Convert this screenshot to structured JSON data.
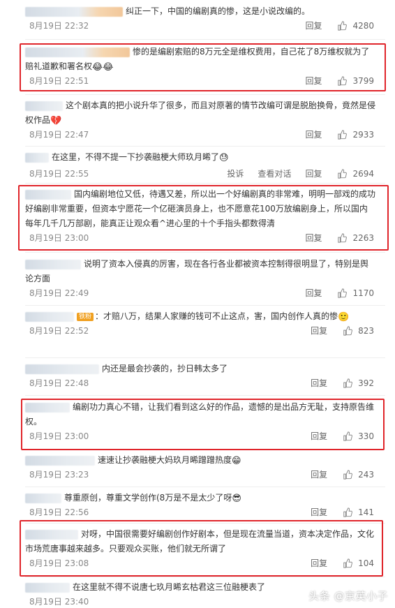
{
  "labels": {
    "reply": "回复",
    "report": "投诉",
    "view_conversation": "查看对话"
  },
  "comments": [
    {
      "text": "纠正一下，中国的编剧真的惨，这是小说改编的。",
      "emoji": "",
      "badge": "",
      "time": "8月19日 22:32",
      "likes": "4280",
      "highlighted": false
    },
    {
      "text": "惨的是编剧索赔的8万元全是维权费用，自己花了8万维权就为了赔礼道歉和署名权",
      "emoji": "😂😂",
      "badge": "",
      "time": "8月19日 22:51",
      "likes": "3799",
      "highlighted": true
    },
    {
      "text": "这个剧本真的把小说升华了很多，而且对原著的情节改编可谓是脱胎换骨，竟然是侵权作品",
      "emoji": "💔",
      "badge": "",
      "time": "8月19日 22:47",
      "likes": "2933",
      "highlighted": false
    },
    {
      "text": "在这里，不得不提一下抄袭融梗大师玖月晞了",
      "emoji": "😓",
      "badge": "",
      "time": "8月19日 22:55",
      "likes": "2694",
      "highlighted": false,
      "extra_actions": true
    },
    {
      "text": "国内编剧地位又低，待遇又差，所以出一个好编剧真的非常难，明明一部戏的成功好编剧非常重要，但资本宁愿花一个亿砸演员身上，也不愿意花100万放编剧身上，所以国内每年几千几万部剧，能真正让观众看^进心里的十个手指头都数得清",
      "emoji": "",
      "badge": "",
      "time": "8月19日 23:00",
      "likes": "2263",
      "highlighted": true
    },
    {
      "text": "说明了资本入侵真的厉害，现在各行各业都被资本控制得很明显了，特别是舆论方面",
      "emoji": "",
      "badge": "",
      "time": "8月19日 22:49",
      "likes": "1170",
      "highlighted": false
    },
    {
      "text": "：才赔八万，结果人家赚的钱可不止这点，害，国内创作人真的惨",
      "emoji": "🙂",
      "badge": "铁粉",
      "time": "8月19日 22:52",
      "likes": "823",
      "highlighted": false
    },
    {
      "text": "内还是最会抄袭的，抄日韩太多了",
      "emoji": "",
      "badge": "",
      "time": "8月19日 22:48",
      "likes": "392",
      "highlighted": false
    },
    {
      "text": "编剧功力真心不错，让我们看到这么好的作品，遗憾的是出品方无耻，支持原告维权。",
      "emoji": "",
      "badge": "",
      "time": "8月19日 23:00",
      "likes": "330",
      "highlighted": true
    },
    {
      "text": "速速让抄袭融梗大妈玖月晞蹭蹭热度",
      "emoji": "😁",
      "badge": "",
      "time": "8月19日 23:23",
      "likes": "243",
      "highlighted": false
    },
    {
      "text": "尊重原创，尊重文学创作(8万是不是太少了呀",
      "emoji": "😎",
      "badge": "",
      "time": "8月19日 22:56",
      "likes": "141",
      "highlighted": false
    },
    {
      "text": "对呀，中国很需要好编剧创作好剧本，但是现在流量当道，资本决定作品，文化市场荒唐事越来越多。只要观众买账，他们就无所谓了",
      "emoji": "",
      "badge": "",
      "time": "8月19日 23:08",
      "likes": "104",
      "highlighted": true
    },
    {
      "text": "在这里就不得不说唐七玖月晞玄枯君这三位融梗表了",
      "emoji": "",
      "badge": "",
      "time": "8月19日 23:40",
      "likes": "",
      "highlighted": false
    }
  ],
  "watermark": "头条 @京英小子",
  "colors": {
    "highlight_border": "#e0242a",
    "meta_text": "#888888",
    "body_text": "#333333"
  }
}
